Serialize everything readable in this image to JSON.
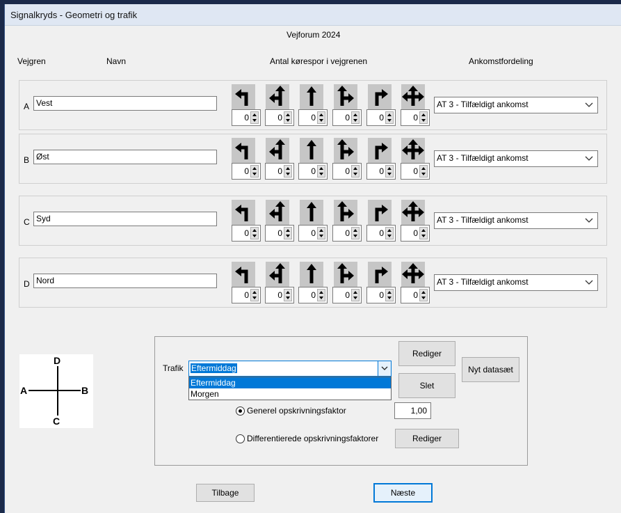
{
  "window": {
    "title": "Signalkryds - Geometri og trafik",
    "subtitle": "Vejforum 2024"
  },
  "headers": {
    "vejgren": "Vejgren",
    "navn": "Navn",
    "lanes": "Antal kørespor i vejgrenen",
    "arrival": "Ankomstfordeling"
  },
  "lane_icons": [
    "turn-left-icon",
    "left-straight-icon",
    "straight-icon",
    "straight-right-icon",
    "turn-right-icon",
    "all-directions-icon"
  ],
  "approaches": [
    {
      "letter": "A",
      "name": "Vest",
      "lanes": [
        "0",
        "0",
        "0",
        "0",
        "0",
        "0"
      ],
      "arrival": "AT 3 - Tilfældigt ankomst"
    },
    {
      "letter": "B",
      "name": "Øst",
      "lanes": [
        "0",
        "0",
        "0",
        "0",
        "0",
        "0"
      ],
      "arrival": "AT 3 - Tilfældigt ankomst"
    },
    {
      "letter": "C",
      "name": "Syd",
      "lanes": [
        "0",
        "0",
        "0",
        "0",
        "0",
        "0"
      ],
      "arrival": "AT 3 - Tilfældigt ankomst"
    },
    {
      "letter": "D",
      "name": "Nord",
      "lanes": [
        "0",
        "0",
        "0",
        "0",
        "0",
        "0"
      ],
      "arrival": "AT 3 - Tilfældigt ankomst"
    }
  ],
  "diagram": {
    "top": "D",
    "left": "A",
    "right": "B",
    "bottom": "C"
  },
  "traffic": {
    "label": "Trafik",
    "selected": "Eftermiddag",
    "options": [
      "Eftermiddag",
      "Morgen"
    ],
    "rediger_label": "Rediger",
    "slet_label": "Slet",
    "nyt_label": "Nyt datasæt",
    "general_factor_label": "Generel opskrivningsfaktor",
    "general_factor_value": "1,00",
    "diff_factor_label": "Differentierede opskrivningsfaktorer",
    "diff_rediger_label": "Rediger",
    "general_selected": true
  },
  "nav": {
    "back_label": "Tilbage",
    "next_label": "Næste"
  },
  "colors": {
    "selection": "#0078d7",
    "accent_border": "#0078d7"
  }
}
